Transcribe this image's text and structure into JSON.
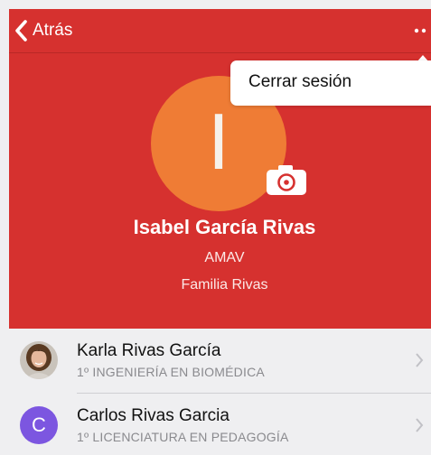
{
  "nav": {
    "back_label": "Atrás"
  },
  "menu": {
    "logout_label": "Cerrar sesión"
  },
  "profile": {
    "initial": "I",
    "name": "Isabel García Rivas",
    "organization": "AMAV",
    "family": "Familia Rivas"
  },
  "children": [
    {
      "name": "Karla Rivas García",
      "program": "1º INGENIERÍA EN BIOMÉDICA",
      "avatar": "photo"
    },
    {
      "name": "Carlos Rivas Garcia",
      "program": "1º LICENCIATURA EN PEDAGOGÍA",
      "avatar_letter": "C"
    }
  ],
  "colors": {
    "header": "#d6312f",
    "avatar": "#ef7c35",
    "child_avatar": "#7c56e0",
    "background": "#efeff1"
  },
  "icons": [
    "chevron-left-icon",
    "more-icon",
    "camera-icon",
    "chevron-right-icon"
  ]
}
